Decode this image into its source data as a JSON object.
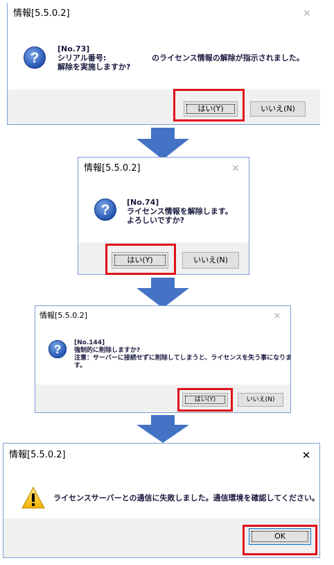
{
  "dialog1": {
    "title": "情報[5.5.0.2]",
    "close_glyph": "✕",
    "icon": "question-icon",
    "line1": "[No.73]",
    "line2_prefix": "シリアル番号:",
    "line2_suffix": "のライセンス情報の解除が指示されました。",
    "line3": "解除を実施しますか?",
    "yes_label": "はい(Y)",
    "no_label": "いいえ(N)"
  },
  "dialog2": {
    "title": "情報[5.5.0.2]",
    "close_glyph": "✕",
    "icon": "question-icon",
    "line1": "[No.74]",
    "line2": "ライセンス情報を解除します。",
    "line3": "よろしいですか?",
    "yes_label": "はい(Y)",
    "no_label": "いいえ(N)"
  },
  "dialog3": {
    "title": "情報[5.5.0.2]",
    "close_glyph": "✕",
    "icon": "question-icon",
    "line1": "[No.144]",
    "line2": "強制的に削除しますか?",
    "line3": "注意：サーバーに接続せずに削除してしまうと、ライセンスを失う事になりま",
    "line4": "す。",
    "yes_label": "はい(Y)",
    "no_label": "いいえ(N)"
  },
  "dialog4": {
    "title": "情報[5.5.0.2]",
    "close_glyph": "✕",
    "icon": "warning-icon",
    "message": "ライセンスサーバーとの通信に失敗しました。通信環境を確認してください。",
    "ok_label": "OK"
  },
  "colors": {
    "highlight": "#e0101a",
    "arrow": "#4472c4"
  }
}
